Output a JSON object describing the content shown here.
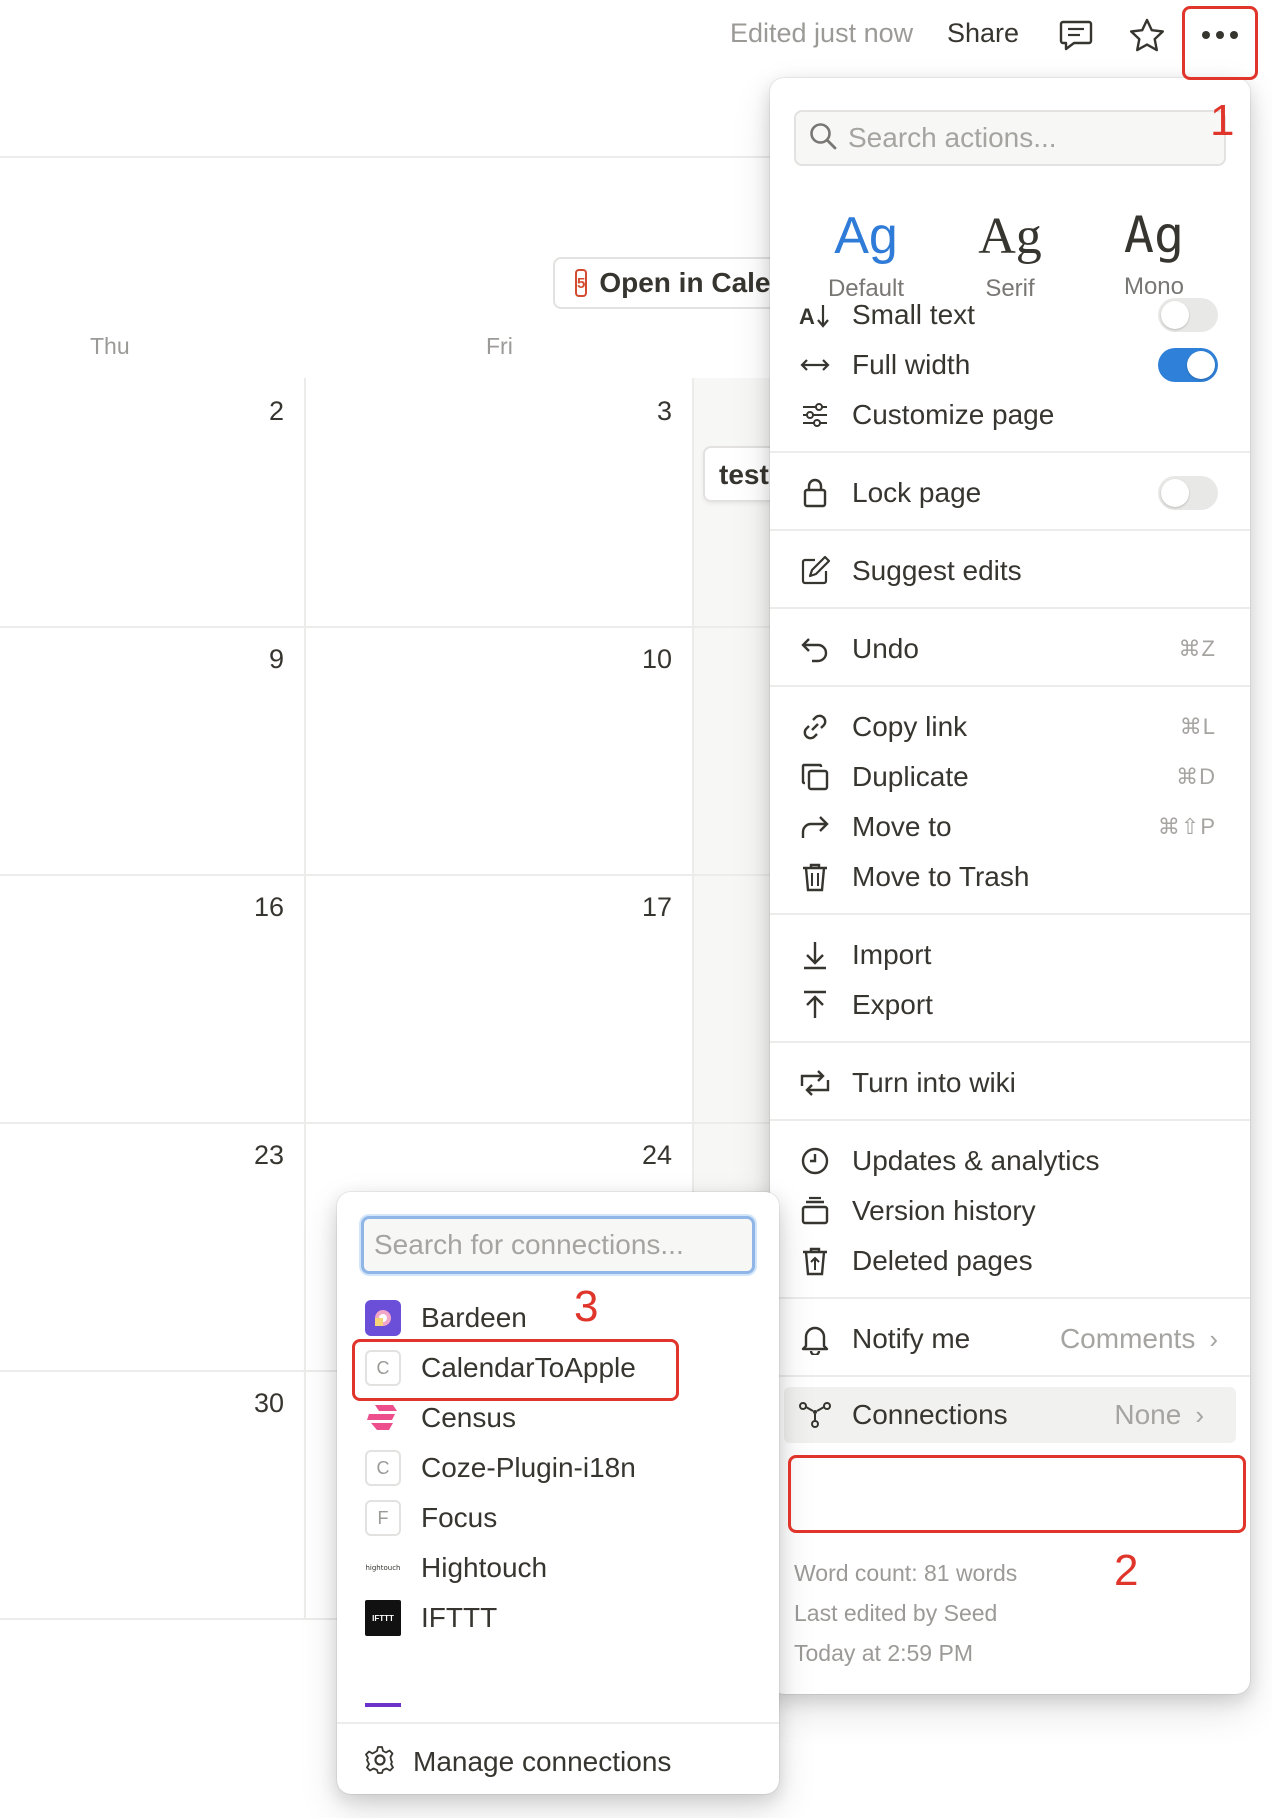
{
  "topbar": {
    "edited_status": "Edited just now",
    "share_label": "Share",
    "icons": [
      "comment-icon",
      "star-icon",
      "more-icon"
    ]
  },
  "calendar": {
    "open_button_label": "Open in Calendar",
    "weekdays": [
      "Thu",
      "Fri"
    ],
    "days": [
      "2",
      "3",
      "9",
      "10",
      "16",
      "17",
      "23",
      "24",
      "30"
    ],
    "event_label": "test"
  },
  "annotations": [
    "1",
    "2",
    "3"
  ],
  "menu": {
    "search_placeholder": "Search actions...",
    "fonts": [
      {
        "glyph": "Ag",
        "label": "Default"
      },
      {
        "glyph": "Ag",
        "label": "Serif"
      },
      {
        "glyph": "Ag",
        "label": "Mono"
      }
    ],
    "small_text": "Small text",
    "full_width": "Full width",
    "customize_page": "Customize page",
    "lock_page": "Lock page",
    "suggest_edits": "Suggest edits",
    "undo": {
      "label": "Undo",
      "shortcut": "⌘Z"
    },
    "copy_link": {
      "label": "Copy link",
      "shortcut": "⌘L"
    },
    "duplicate": {
      "label": "Duplicate",
      "shortcut": "⌘D"
    },
    "move_to": {
      "label": "Move to",
      "shortcut": "⌘⇧P"
    },
    "move_to_trash": "Move to Trash",
    "import": "Import",
    "export": "Export",
    "turn_into_wiki": "Turn into wiki",
    "updates_analytics": "Updates & analytics",
    "version_history": "Version history",
    "deleted_pages": "Deleted pages",
    "notify_me": {
      "label": "Notify me",
      "value": "Comments"
    },
    "connections": {
      "label": "Connections",
      "value": "None"
    },
    "footer": {
      "word_count": "Word count: 81 words",
      "last_edited_by": "Last edited by Seed",
      "last_edited_at": "Today at 2:59 PM"
    },
    "toggles": {
      "small_text": false,
      "full_width": true,
      "lock_page": false
    },
    "accent_color": "#2f80d8"
  },
  "connections_menu": {
    "search_placeholder": "Search for connections...",
    "items": [
      {
        "name": "Bardeen",
        "logo": "bardeen-logo"
      },
      {
        "name": "CalendarToApple",
        "logo": "C"
      },
      {
        "name": "Census",
        "logo": "census-logo"
      },
      {
        "name": "Coze-Plugin-i18n",
        "logo": "C"
      },
      {
        "name": "Focus",
        "logo": "F"
      },
      {
        "name": "Hightouch",
        "logo": "hightouch"
      },
      {
        "name": "IFTTT",
        "logo": "IFTTT"
      }
    ],
    "manage_label": "Manage connections"
  },
  "highlight_color": "#e0352b"
}
